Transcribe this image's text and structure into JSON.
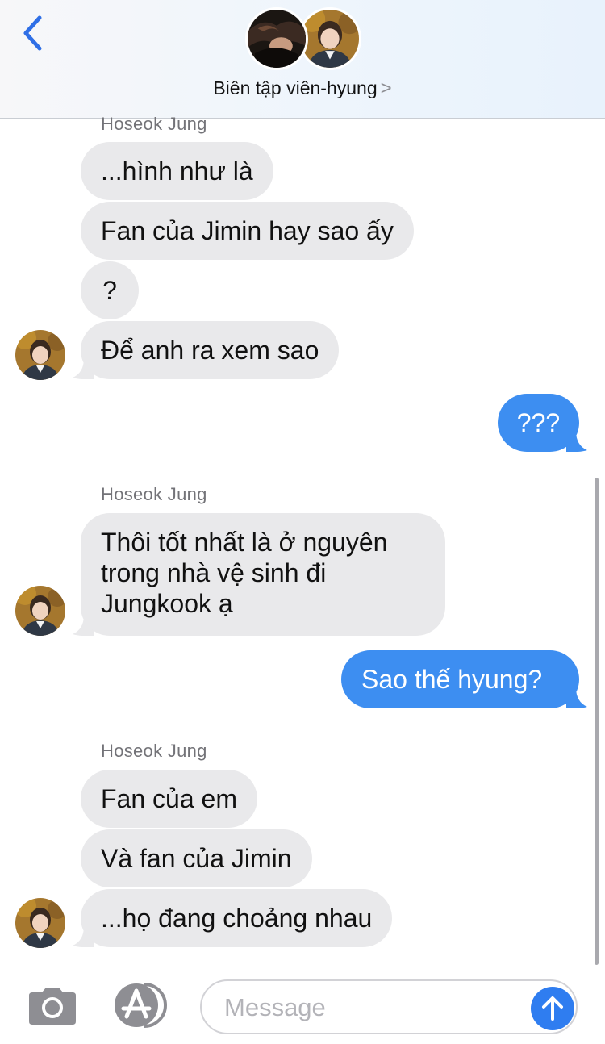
{
  "header": {
    "contact_name": "Biên tập viên-hyung",
    "back_icon": "chevron-left-icon",
    "name_chevron": ">"
  },
  "colors": {
    "accent": "#3d8ef1",
    "incoming_bubble": "#e9e9eb",
    "outgoing_bubble": "#3d8ef1",
    "send_button": "#2f7df0"
  },
  "messages": [
    {
      "sender_label": "Hoseok Jung"
    },
    {
      "text": "...hình như là"
    },
    {
      "text": "Fan của Jimin hay sao ấy"
    },
    {
      "text": "?"
    },
    {
      "text": "Để anh ra xem sao"
    },
    {
      "text": "???"
    },
    {
      "sender_label": "Hoseok Jung"
    },
    {
      "line1": "Thôi tốt nhất là ở nguyên",
      "line2": "trong nhà vệ sinh đi",
      "line3": "Jungkook ạ"
    },
    {
      "text": "Sao thế hyung?"
    },
    {
      "sender_label": "Hoseok Jung"
    },
    {
      "text": "Fan của em"
    },
    {
      "text": "Và fan của Jimin"
    },
    {
      "text": "...họ đang choảng nhau"
    }
  ],
  "composer": {
    "placeholder": "Message",
    "camera_icon": "camera-icon",
    "apps_icon": "app-store-icon",
    "send_icon": "arrow-up-icon"
  }
}
